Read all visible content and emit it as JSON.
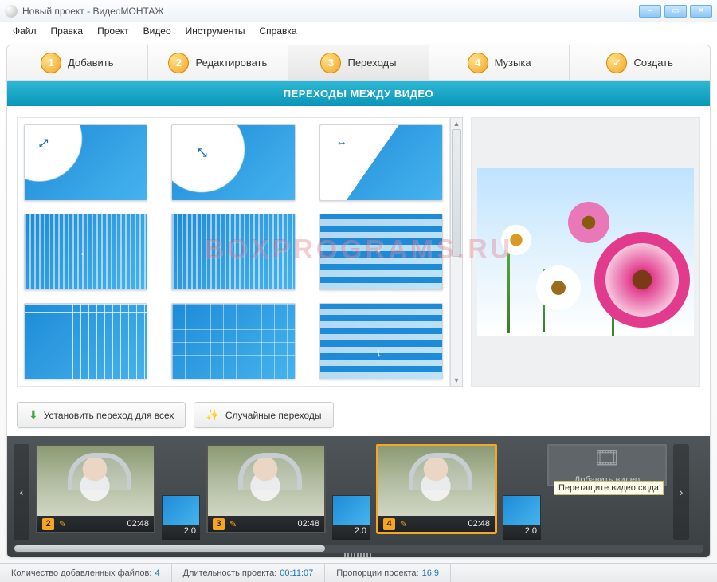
{
  "window": {
    "title": "Новый проект - ВидеоМОНТАЖ"
  },
  "menus": [
    "Файл",
    "Правка",
    "Проект",
    "Видео",
    "Инструменты",
    "Справка"
  ],
  "steps": [
    {
      "num": "1",
      "label": "Добавить"
    },
    {
      "num": "2",
      "label": "Редактировать"
    },
    {
      "num": "3",
      "label": "Переходы",
      "active": true
    },
    {
      "num": "4",
      "label": "Музыка"
    },
    {
      "num": "✓",
      "label": "Создать",
      "check": true
    }
  ],
  "section_header": "ПЕРЕХОДЫ МЕЖДУ ВИДЕО",
  "buttons": {
    "apply_all": "Установить переход для всех",
    "random": "Случайные переходы"
  },
  "timeline": {
    "clips": [
      {
        "num": "2",
        "time": "02:48"
      },
      {
        "num": "3",
        "time": "02:48"
      },
      {
        "num": "4",
        "time": "02:48",
        "selected": true
      }
    ],
    "transition_duration": "2.0",
    "drop_hint": "Перетащите видео сюда",
    "drop_label": "Добавить видео"
  },
  "status": {
    "files_label": "Количество добавленных файлов:",
    "files_value": "4",
    "duration_label": "Длительность проекта:",
    "duration_value": "00:11:07",
    "ratio_label": "Пропорции проекта:",
    "ratio_value": "16:9"
  },
  "watermark": "BOXPROGRAMS.RU"
}
